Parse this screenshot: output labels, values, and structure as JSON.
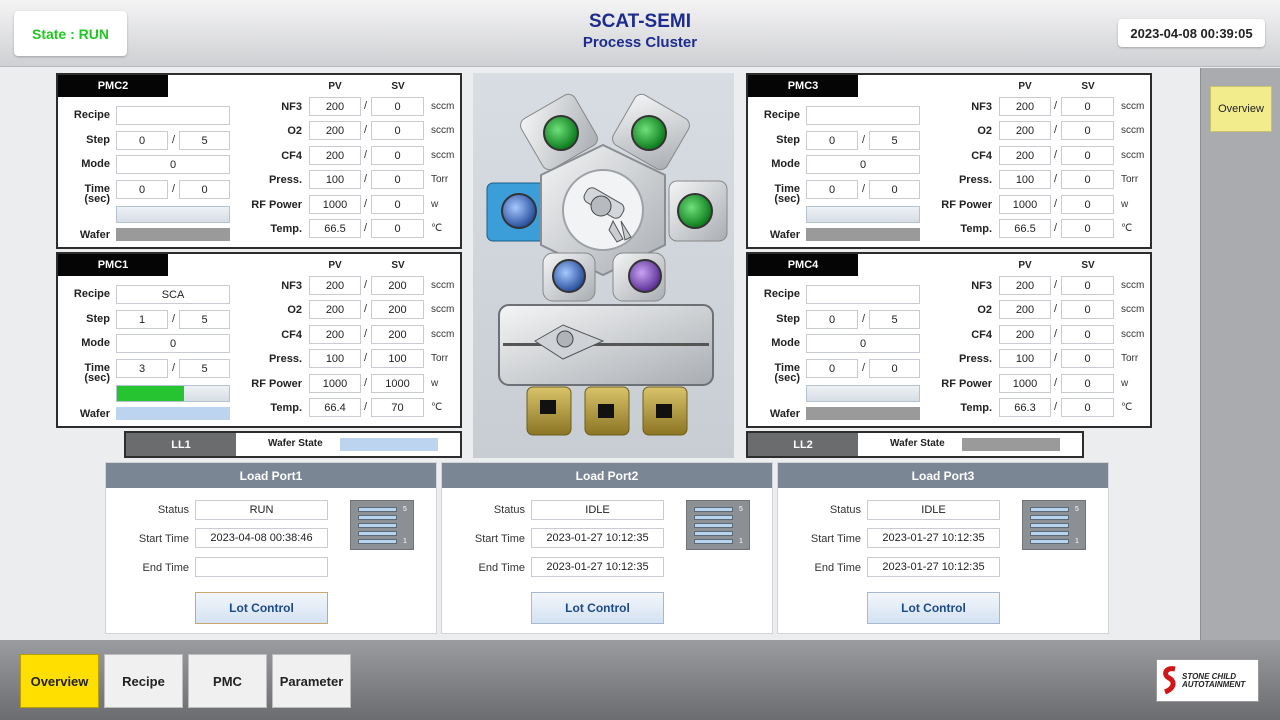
{
  "header": {
    "state": "State : RUN",
    "title": "SCAT-SEMI",
    "subtitle": "Process Cluster",
    "datetime": "2023-04-08 00:39:05"
  },
  "side_panel": {
    "overview": "Overview"
  },
  "pmc_labels": {
    "pv": "PV",
    "sv": "SV",
    "recipe": "Recipe",
    "step": "Step",
    "mode": "Mode",
    "time": "Time",
    "time_sec": "(sec)",
    "wafer": "Wafer",
    "nf3": "NF3",
    "o2": "O2",
    "cf4": "CF4",
    "press": "Press.",
    "rf_power": "RF Power",
    "temp": "Temp.",
    "slash": "/",
    "u_sccm": "sccm",
    "u_torr": "Torr",
    "u_w": "w",
    "u_c": "℃"
  },
  "pmcs": {
    "pmc2": {
      "name": "PMC2",
      "recipe": "",
      "step_cur": "0",
      "step_total": "5",
      "mode": "0",
      "time_cur": "0",
      "time_total": "0",
      "progress": 0,
      "wafer_color": "#9a9a9a",
      "nf3_pv": "200",
      "nf3_sv": "0",
      "o2_pv": "200",
      "o2_sv": "0",
      "cf4_pv": "200",
      "cf4_sv": "0",
      "press_pv": "100",
      "press_sv": "0",
      "rf_pv": "1000",
      "rf_sv": "0",
      "temp_pv": "66.5",
      "temp_sv": "0"
    },
    "pmc1": {
      "name": "PMC1",
      "recipe": "SCA",
      "step_cur": "1",
      "step_total": "5",
      "mode": "0",
      "time_cur": "3",
      "time_total": "5",
      "progress": 0.6,
      "wafer_color": "#bcd4f0",
      "nf3_pv": "200",
      "nf3_sv": "200",
      "o2_pv": "200",
      "o2_sv": "200",
      "cf4_pv": "200",
      "cf4_sv": "200",
      "press_pv": "100",
      "press_sv": "100",
      "rf_pv": "1000",
      "rf_sv": "1000",
      "temp_pv": "66.4",
      "temp_sv": "70"
    },
    "pmc3": {
      "name": "PMC3",
      "recipe": "",
      "step_cur": "0",
      "step_total": "5",
      "mode": "0",
      "time_cur": "0",
      "time_total": "0",
      "progress": 0,
      "wafer_color": "#9a9a9a",
      "nf3_pv": "200",
      "nf3_sv": "0",
      "o2_pv": "200",
      "o2_sv": "0",
      "cf4_pv": "200",
      "cf4_sv": "0",
      "press_pv": "100",
      "press_sv": "0",
      "rf_pv": "1000",
      "rf_sv": "0",
      "temp_pv": "66.5",
      "temp_sv": "0"
    },
    "pmc4": {
      "name": "PMC4",
      "recipe": "",
      "step_cur": "0",
      "step_total": "5",
      "mode": "0",
      "time_cur": "0",
      "time_total": "0",
      "progress": 0,
      "wafer_color": "#9a9a9a",
      "nf3_pv": "200",
      "nf3_sv": "0",
      "o2_pv": "200",
      "o2_sv": "0",
      "cf4_pv": "200",
      "cf4_sv": "0",
      "press_pv": "100",
      "press_sv": "0",
      "rf_pv": "1000",
      "rf_sv": "0",
      "temp_pv": "66.3",
      "temp_sv": "0"
    }
  },
  "load_locks": {
    "wafer_state_label": "Wafer State",
    "ll1": {
      "name": "LL1",
      "wafer_color": "#bcd4f0"
    },
    "ll2": {
      "name": "LL2",
      "wafer_color": "#9a9a9a"
    }
  },
  "load_port_labels": {
    "status": "Status",
    "start_time": "Start Time",
    "end_time": "End Time",
    "lot_control": "Lot Control",
    "slot_top": "5",
    "slot_bottom": "1"
  },
  "load_ports": {
    "lp1": {
      "name": "Load Port1",
      "status": "RUN",
      "start_time": "2023-04-08 00:38:46",
      "end_time": ""
    },
    "lp2": {
      "name": "Load Port2",
      "status": "IDLE",
      "start_time": "2023-01-27 10:12:35",
      "end_time": "2023-01-27 10:12:35"
    },
    "lp3": {
      "name": "Load Port3",
      "status": "IDLE",
      "start_time": "2023-01-27 10:12:35",
      "end_time": "2023-01-27 10:12:35"
    }
  },
  "nav": {
    "overview": "Overview",
    "recipe": "Recipe",
    "pmc": "PMC",
    "parameter": "Parameter"
  },
  "logo": {
    "line1": "STONE CHILD",
    "line2": "AUTOTAINMENT"
  },
  "colors": {
    "run_green": "#1ec81e",
    "title_blue": "#1d2c8e",
    "active_nav": "#ffdf00"
  }
}
